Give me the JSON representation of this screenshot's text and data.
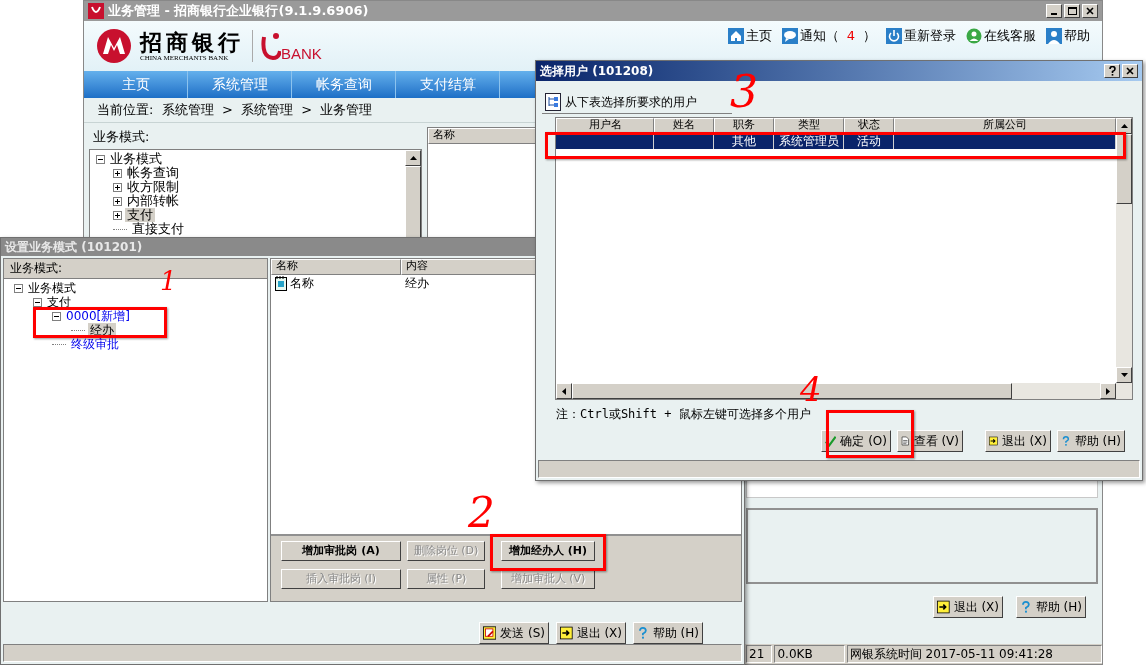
{
  "main_window": {
    "title": "业务管理 - 招商银行企业银行(9.1.9.6906)",
    "logo": {
      "name_cn": "招商银行",
      "name_en": "CHINA MERCHANTS BANK",
      "product": "BANK"
    },
    "top_links": [
      {
        "kind": "home",
        "label": "主页"
      },
      {
        "kind": "notice",
        "label": "通知（",
        "count": "4",
        "suffix": "）"
      },
      {
        "kind": "power",
        "label": "重新登录"
      },
      {
        "kind": "service",
        "label": "在线客服"
      },
      {
        "kind": "help",
        "label": "帮助"
      }
    ],
    "nav_tabs": [
      {
        "label": "主页",
        "selected": false
      },
      {
        "label": "系统管理",
        "selected": false
      },
      {
        "label": "帐务查询",
        "selected": false
      },
      {
        "label": "支付结算",
        "selected": false
      }
    ],
    "breadcrumb": "当前位置:  系统管理  >  系统管理  >  业务管理",
    "tree_label": "业务模式:",
    "tree": [
      {
        "label": "业务模式",
        "expanded": true,
        "selected": false,
        "children": [
          {
            "label": "帐务查询",
            "expanded": false,
            "selected": false
          },
          {
            "label": "收方限制",
            "expanded": false,
            "selected": false
          },
          {
            "label": "内部转帐",
            "expanded": false,
            "selected": false
          },
          {
            "label": "支付",
            "expanded": false,
            "selected": true
          },
          {
            "label": "直接支付",
            "selected": false
          }
        ]
      }
    ],
    "list_columns": [
      "名称"
    ],
    "buttons": [
      {
        "kind": "exit",
        "label": "退出 (X)"
      },
      {
        "kind": "help",
        "label": "帮助 (H)"
      }
    ],
    "status_bar": [
      "21",
      "0.0KB",
      "网银系统时间 2017-05-11 09:41:28"
    ]
  },
  "mode_dialog": {
    "title": "设置业务模式 (101201)",
    "tree_label": "业务模式:",
    "tree": [
      {
        "label": "业务模式",
        "expanded": true,
        "selected": false,
        "added": false,
        "children": [
          {
            "label": "支付",
            "expanded": true,
            "selected": false,
            "added": false,
            "children": [
              {
                "label": "0000[新增]",
                "expanded": true,
                "selected": false,
                "added": true,
                "children": [
                  {
                    "label": "经办",
                    "selected": true,
                    "added": false
                  }
                ]
              },
              {
                "label": "终级审批",
                "selected": false,
                "added": true
              }
            ]
          }
        ]
      }
    ],
    "list_columns": [
      "名称",
      "内容"
    ],
    "list_rows": [
      [
        "名称",
        "经办"
      ]
    ],
    "action_buttons": [
      {
        "label": "增加审批岗 (A)",
        "disabled": false
      },
      {
        "label": "删除岗位 (D)",
        "disabled": true
      },
      {
        "label": "增加经办人 (H)",
        "disabled": false
      },
      {
        "label": "插入审批岗 (I)",
        "disabled": true
      },
      {
        "label": "属性 (P)",
        "disabled": true
      },
      {
        "label": "增加审批人 (V)",
        "disabled": true
      }
    ],
    "buttons": [
      {
        "kind": "send",
        "label": "发送 (S)"
      },
      {
        "kind": "exit",
        "label": "退出 (X)"
      },
      {
        "kind": "help",
        "label": "帮助 (H)"
      }
    ]
  },
  "user_dialog": {
    "title": "选择用户 (101208)",
    "heading": "从下表选择所要求的用户",
    "columns": [
      "用户名",
      "姓名",
      "职务",
      "类型",
      "状态",
      "所属公司"
    ],
    "rows": [
      {
        "selected": true,
        "cells": [
          "",
          "",
          "其他",
          "系统管理员",
          "活动",
          ""
        ]
      }
    ],
    "note": "注：Ctrl或Shift + 鼠标左键可选择多个用户",
    "buttons": [
      {
        "kind": "ok",
        "label": "确定 (O)"
      },
      {
        "kind": "view",
        "label": "查看 (V)"
      },
      {
        "kind": "exit",
        "label": "退出 (X)"
      },
      {
        "kind": "help",
        "label": "帮助 (H)"
      }
    ]
  },
  "annotations": [
    {
      "label": "1"
    },
    {
      "label": "2"
    },
    {
      "label": "3"
    },
    {
      "label": "4"
    }
  ]
}
